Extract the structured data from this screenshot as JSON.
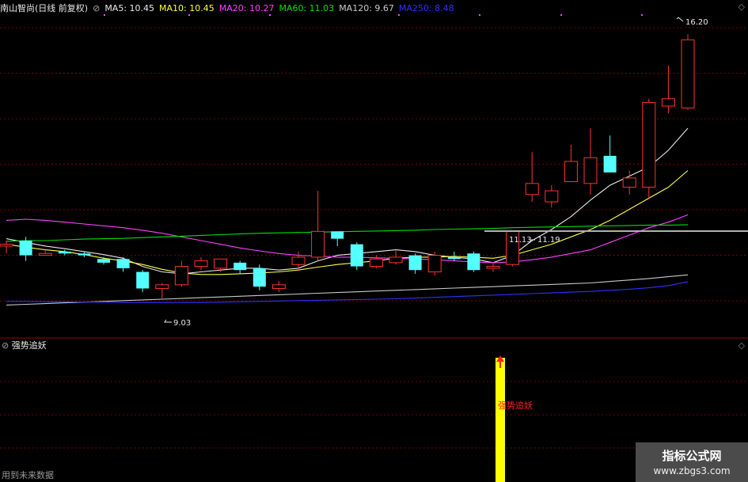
{
  "header": {
    "stock": "南山智尚(日线 前复权)",
    "ma_items": [
      {
        "text": "MA5: 10.45",
        "color": "#e8e8e8"
      },
      {
        "text": "MA10: 10.45",
        "color": "#ffff40"
      },
      {
        "text": "MA20: 10.27",
        "color": "#ff40ff"
      },
      {
        "text": "MA60: 11.03",
        "color": "#00e000"
      },
      {
        "text": "MA120: 9.67",
        "color": "#c8c8c8"
      },
      {
        "text": "MA250: 8.48",
        "color": "#3030ff"
      }
    ]
  },
  "indicator": {
    "title": "强势追妖",
    "signal_label": "强势追妖"
  },
  "footer": {
    "future_note": "用到未来数据"
  },
  "watermark": {
    "line1": "指标公式网",
    "line2": "www.zbgs3.com"
  },
  "colors": {
    "up": "#ff3232",
    "down": "#54ffff",
    "grid": "#7a0000",
    "signal": "#ffff00"
  },
  "chart_data": {
    "type": "candlestick",
    "price_axis_range": [
      8.0,
      16.7
    ],
    "annotations": {
      "high": "16.20",
      "low": "9.03",
      "mid_left": "11.13",
      "mid_right": "11.19"
    },
    "candles": [
      {
        "o": 10.45,
        "h": 10.6,
        "l": 10.25,
        "c": 10.5
      },
      {
        "o": 10.6,
        "h": 10.7,
        "l": 10.05,
        "c": 10.2
      },
      {
        "o": 10.2,
        "h": 10.35,
        "l": 10.2,
        "c": 10.25
      },
      {
        "o": 10.3,
        "h": 10.35,
        "l": 10.2,
        "c": 10.25
      },
      {
        "o": 10.25,
        "h": 10.3,
        "l": 10.15,
        "c": 10.2
      },
      {
        "o": 10.1,
        "h": 10.15,
        "l": 9.95,
        "c": 10.0
      },
      {
        "o": 10.1,
        "h": 10.15,
        "l": 9.75,
        "c": 9.85
      },
      {
        "o": 9.75,
        "h": 9.8,
        "l": 9.2,
        "c": 9.3
      },
      {
        "o": 9.3,
        "h": 9.45,
        "l": 9.03,
        "c": 9.4
      },
      {
        "o": 9.4,
        "h": 10.05,
        "l": 9.35,
        "c": 9.9
      },
      {
        "o": 9.9,
        "h": 10.15,
        "l": 9.8,
        "c": 10.05
      },
      {
        "o": 9.85,
        "h": 10.1,
        "l": 9.75,
        "c": 10.1
      },
      {
        "o": 10.0,
        "h": 10.05,
        "l": 9.7,
        "c": 9.8
      },
      {
        "o": 9.85,
        "h": 9.95,
        "l": 9.25,
        "c": 9.35
      },
      {
        "o": 9.3,
        "h": 9.5,
        "l": 9.2,
        "c": 9.4
      },
      {
        "o": 9.95,
        "h": 10.3,
        "l": 9.8,
        "c": 10.15
      },
      {
        "o": 10.15,
        "h": 11.95,
        "l": 10.05,
        "c": 10.85
      },
      {
        "o": 10.85,
        "h": 10.85,
        "l": 10.45,
        "c": 10.65
      },
      {
        "o": 10.5,
        "h": 10.55,
        "l": 9.8,
        "c": 9.9
      },
      {
        "o": 9.9,
        "h": 10.2,
        "l": 9.85,
        "c": 10.1
      },
      {
        "o": 10.0,
        "h": 10.35,
        "l": 9.95,
        "c": 10.15
      },
      {
        "o": 10.2,
        "h": 10.25,
        "l": 9.7,
        "c": 9.8
      },
      {
        "o": 9.75,
        "h": 10.3,
        "l": 9.65,
        "c": 10.2
      },
      {
        "o": 10.15,
        "h": 10.3,
        "l": 10.05,
        "c": 10.1
      },
      {
        "o": 10.25,
        "h": 10.3,
        "l": 9.75,
        "c": 9.8
      },
      {
        "o": 9.85,
        "h": 10.0,
        "l": 9.75,
        "c": 9.9
      },
      {
        "o": 9.95,
        "h": 10.85,
        "l": 9.9,
        "c": 10.85
      },
      {
        "o": 11.85,
        "h": 13.0,
        "l": 11.65,
        "c": 12.15
      },
      {
        "o": 11.65,
        "h": 12.1,
        "l": 11.5,
        "c": 11.95
      },
      {
        "o": 12.2,
        "h": 13.2,
        "l": 12.2,
        "c": 12.75
      },
      {
        "o": 12.15,
        "h": 13.65,
        "l": 11.85,
        "c": 12.85
      },
      {
        "o": 12.9,
        "h": 13.45,
        "l": 12.45,
        "c": 12.45
      },
      {
        "o": 12.05,
        "h": 12.5,
        "l": 11.85,
        "c": 12.3
      },
      {
        "o": 12.05,
        "h": 14.45,
        "l": 11.75,
        "c": 14.35
      },
      {
        "o": 14.25,
        "h": 15.35,
        "l": 14.05,
        "c": 14.45
      },
      {
        "o": 14.2,
        "h": 16.2,
        "l": 14.15,
        "c": 16.05
      }
    ],
    "ma_lines": {
      "MA5": [
        10.65,
        10.55,
        10.45,
        10.38,
        10.3,
        10.22,
        10.12,
        9.9,
        9.75,
        9.7,
        9.75,
        9.8,
        9.85,
        9.85,
        9.8,
        9.85,
        10.05,
        10.2,
        10.25,
        10.3,
        10.35,
        10.3,
        10.2,
        10.15,
        10.1,
        10.0,
        10.2,
        10.6,
        10.9,
        11.25,
        11.7,
        12.1,
        12.35,
        12.6,
        13.05,
        13.65
      ],
      "MA10": [
        10.5,
        10.42,
        10.35,
        10.3,
        10.22,
        10.12,
        10.05,
        9.95,
        9.82,
        9.72,
        9.68,
        9.68,
        9.7,
        9.72,
        9.75,
        9.8,
        9.88,
        9.95,
        10.0,
        10.05,
        10.12,
        10.15,
        10.15,
        10.17,
        10.15,
        10.12,
        10.2,
        10.35,
        10.5,
        10.7,
        10.9,
        11.15,
        11.45,
        11.75,
        12.05,
        12.5
      ],
      "MA20": [
        11.15,
        11.18,
        11.15,
        11.1,
        11.05,
        11.0,
        10.95,
        10.88,
        10.8,
        10.7,
        10.6,
        10.5,
        10.4,
        10.32,
        10.25,
        10.2,
        10.18,
        10.15,
        10.15,
        10.13,
        10.12,
        10.1,
        10.08,
        10.05,
        10.02,
        10.0,
        10.02,
        10.08,
        10.15,
        10.25,
        10.35,
        10.55,
        10.75,
        10.95,
        11.1,
        11.3
      ],
      "MA60": [
        10.58,
        10.6,
        10.6,
        10.62,
        10.64,
        10.65,
        10.66,
        10.68,
        10.7,
        10.72,
        10.74,
        10.76,
        10.78,
        10.8,
        10.81,
        10.82,
        10.83,
        10.84,
        10.85,
        10.86,
        10.87,
        10.88,
        10.9,
        10.91,
        10.92,
        10.93,
        10.95,
        10.96,
        10.97,
        10.98,
        10.99,
        11.0,
        11.01,
        11.02,
        11.02,
        11.03
      ],
      "MA120": [
        8.85,
        8.87,
        8.89,
        8.91,
        8.93,
        8.95,
        8.97,
        8.99,
        9.01,
        9.03,
        9.05,
        9.07,
        9.09,
        9.11,
        9.13,
        9.15,
        9.17,
        9.19,
        9.21,
        9.23,
        9.25,
        9.27,
        9.29,
        9.31,
        9.33,
        9.35,
        9.37,
        9.39,
        9.41,
        9.43,
        9.45,
        9.49,
        9.53,
        9.57,
        9.62,
        9.67
      ],
      "MA250": [
        8.95,
        8.95,
        8.94,
        8.94,
        8.93,
        8.93,
        8.92,
        8.92,
        8.92,
        8.92,
        8.92,
        8.93,
        8.94,
        8.95,
        8.96,
        8.97,
        8.98,
        8.99,
        9.0,
        9.01,
        9.02,
        9.04,
        9.06,
        9.08,
        9.1,
        9.12,
        9.14,
        9.16,
        9.18,
        9.2,
        9.22,
        9.25,
        9.28,
        9.32,
        9.38,
        9.48
      ]
    },
    "signal_index": 25
  }
}
